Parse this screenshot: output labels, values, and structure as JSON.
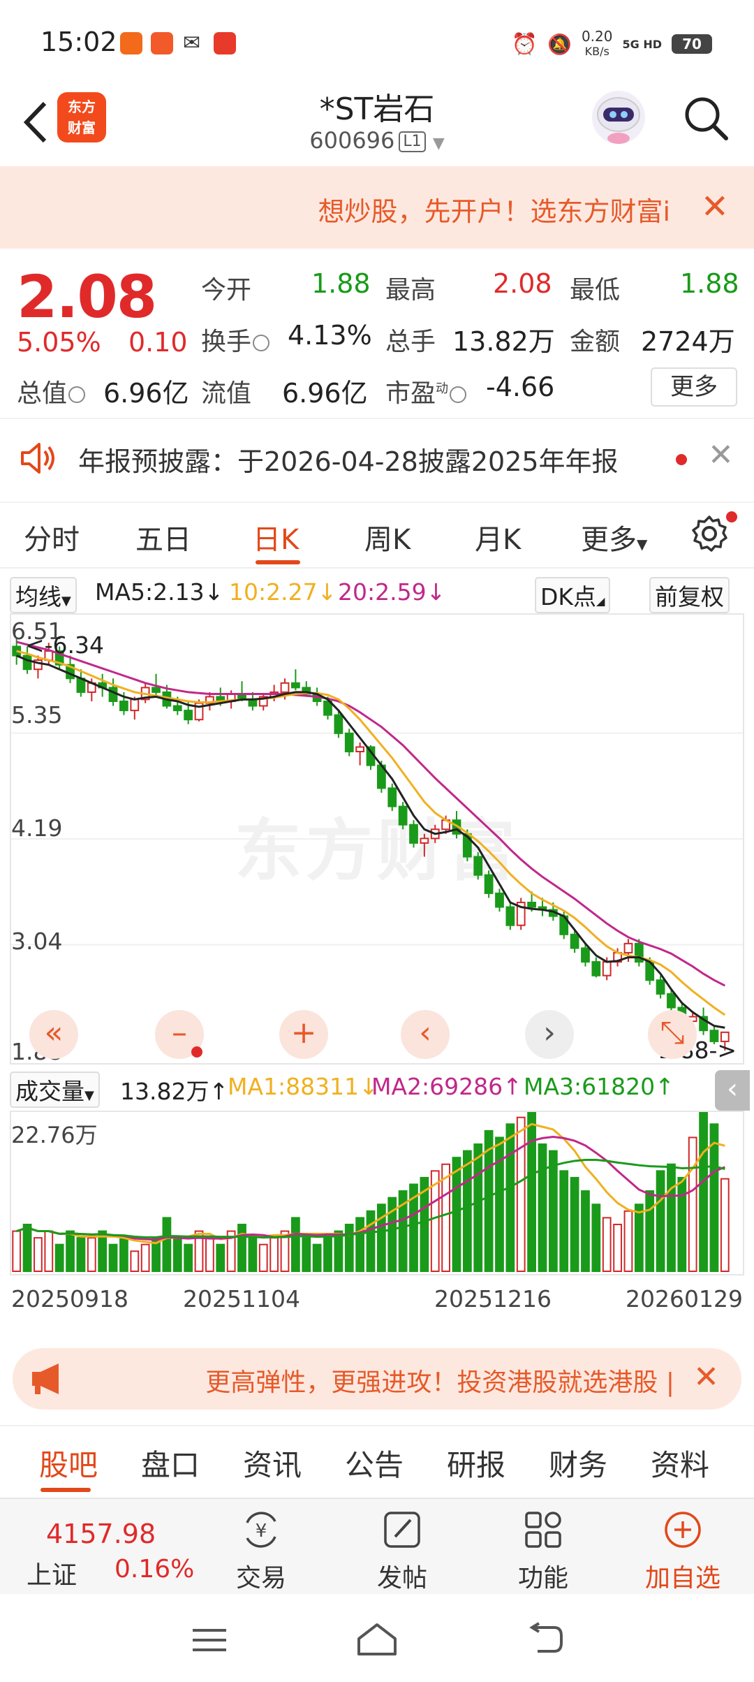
{
  "status_bar": {
    "time": "15:02",
    "net_speed": "0.20",
    "net_unit": "KB/s",
    "signal": "5G HD",
    "battery": "70"
  },
  "header": {
    "back_icon": "chevron-left-icon",
    "logo_line1": "东方",
    "logo_line2": "财富",
    "title": "*ST岩石",
    "code": "600696",
    "level": "L1"
  },
  "promo": {
    "text": "想炒股，先开户！选东方财富i",
    "close": "✕"
  },
  "quote": {
    "price": "2.08",
    "change_pct": "5.05%",
    "change_abs": "0.10",
    "fields": [
      {
        "label": "今开",
        "value": "1.88",
        "color": "green"
      },
      {
        "label": "最高",
        "value": "2.08",
        "color": "red"
      },
      {
        "label": "最低",
        "value": "1.88",
        "color": "green"
      },
      {
        "label": "换手",
        "value": "4.13%",
        "color": "plain"
      },
      {
        "label": "总手",
        "value": "13.82万",
        "color": "plain"
      },
      {
        "label": "金额",
        "value": "2724万",
        "color": "plain"
      },
      {
        "label": "总值",
        "value": "6.96亿",
        "color": "plain"
      },
      {
        "label": "流值",
        "value": "6.96亿",
        "color": "plain"
      },
      {
        "label": "市盈",
        "value": "-4.66",
        "color": "plain"
      }
    ],
    "pe_superscript": "动",
    "more": "更多"
  },
  "announcement": {
    "text": "年报预披露：于2026-04-28披露2025年年报"
  },
  "period_tabs": [
    "分时",
    "五日",
    "日K",
    "周K",
    "月K",
    "更多"
  ],
  "ma": {
    "selector": "均线",
    "ma5": "MA5:2.13",
    "ma10": "10:2.27",
    "ma20": "20:2.59",
    "dk": "DK点",
    "adjust": "前复权",
    "colors": {
      "ma5": "#222222",
      "ma10": "#f0b020",
      "ma20": "#c0288a"
    }
  },
  "chart_data": {
    "type": "candlestick",
    "y_ticks": [
      "6.51",
      "5.35",
      "4.19",
      "3.04",
      "1.88"
    ],
    "max_label": "<-6.34",
    "min_label": "1.88->",
    "watermark": "东方财富",
    "colors": {
      "up": "#d0282a",
      "down": "#1a9a1a"
    },
    "ylim": [
      1.88,
      6.51
    ],
    "candles": [
      [
        6.3,
        6.4,
        6.1,
        6.2
      ],
      [
        6.2,
        6.3,
        6.0,
        6.05
      ],
      [
        6.05,
        6.2,
        5.95,
        6.15
      ],
      [
        6.15,
        6.34,
        6.1,
        6.25
      ],
      [
        6.25,
        6.3,
        6.05,
        6.1
      ],
      [
        6.1,
        6.2,
        5.9,
        5.95
      ],
      [
        5.95,
        6.05,
        5.75,
        5.8
      ],
      [
        5.8,
        5.95,
        5.7,
        5.9
      ],
      [
        5.9,
        6.0,
        5.75,
        5.85
      ],
      [
        5.85,
        5.95,
        5.65,
        5.7
      ],
      [
        5.7,
        5.8,
        5.55,
        5.6
      ],
      [
        5.6,
        5.75,
        5.5,
        5.72
      ],
      [
        5.72,
        5.9,
        5.68,
        5.85
      ],
      [
        5.85,
        6.0,
        5.75,
        5.8
      ],
      [
        5.8,
        5.88,
        5.62,
        5.65
      ],
      [
        5.65,
        5.75,
        5.55,
        5.6
      ],
      [
        5.6,
        5.7,
        5.45,
        5.5
      ],
      [
        5.5,
        5.72,
        5.48,
        5.68
      ],
      [
        5.68,
        5.8,
        5.6,
        5.75
      ],
      [
        5.75,
        5.85,
        5.65,
        5.7
      ],
      [
        5.7,
        5.82,
        5.62,
        5.78
      ],
      [
        5.78,
        5.92,
        5.7,
        5.72
      ],
      [
        5.72,
        5.8,
        5.6,
        5.65
      ],
      [
        5.65,
        5.78,
        5.6,
        5.75
      ],
      [
        5.75,
        5.88,
        5.7,
        5.8
      ],
      [
        5.8,
        5.95,
        5.72,
        5.9
      ],
      [
        5.9,
        6.05,
        5.82,
        5.85
      ],
      [
        5.85,
        5.92,
        5.75,
        5.78
      ],
      [
        5.78,
        5.85,
        5.65,
        5.7
      ],
      [
        5.7,
        5.75,
        5.5,
        5.55
      ],
      [
        5.55,
        5.6,
        5.3,
        5.35
      ],
      [
        5.35,
        5.4,
        5.1,
        5.15
      ],
      [
        5.15,
        5.25,
        5.0,
        5.2
      ],
      [
        5.2,
        5.22,
        4.95,
        5.0
      ],
      [
        5.0,
        5.05,
        4.7,
        4.75
      ],
      [
        4.75,
        4.8,
        4.5,
        4.55
      ],
      [
        4.55,
        4.6,
        4.3,
        4.35
      ],
      [
        4.35,
        4.4,
        4.1,
        4.15
      ],
      [
        4.15,
        4.25,
        4.0,
        4.2
      ],
      [
        4.2,
        4.35,
        4.15,
        4.3
      ],
      [
        4.3,
        4.45,
        4.25,
        4.4
      ],
      [
        4.4,
        4.5,
        4.2,
        4.25
      ],
      [
        4.25,
        4.3,
        3.95,
        4.0
      ],
      [
        4.0,
        4.05,
        3.75,
        3.8
      ],
      [
        3.8,
        3.85,
        3.55,
        3.6
      ],
      [
        3.6,
        3.65,
        3.4,
        3.45
      ],
      [
        3.45,
        3.5,
        3.2,
        3.25
      ],
      [
        3.25,
        3.55,
        3.2,
        3.5
      ],
      [
        3.5,
        3.62,
        3.4,
        3.45
      ],
      [
        3.45,
        3.55,
        3.35,
        3.42
      ],
      [
        3.42,
        3.5,
        3.3,
        3.35
      ],
      [
        3.35,
        3.4,
        3.1,
        3.15
      ],
      [
        3.15,
        3.2,
        2.95,
        3.0
      ],
      [
        3.0,
        3.05,
        2.8,
        2.85
      ],
      [
        2.85,
        2.9,
        2.68,
        2.7
      ],
      [
        2.7,
        2.9,
        2.65,
        2.85
      ],
      [
        2.85,
        3.0,
        2.8,
        2.95
      ],
      [
        2.95,
        3.1,
        2.85,
        3.05
      ],
      [
        3.05,
        3.1,
        2.8,
        2.85
      ],
      [
        2.85,
        2.9,
        2.6,
        2.65
      ],
      [
        2.65,
        2.7,
        2.45,
        2.5
      ],
      [
        2.5,
        2.55,
        2.3,
        2.35
      ],
      [
        2.35,
        2.4,
        2.15,
        2.2
      ],
      [
        2.2,
        2.3,
        2.1,
        2.25
      ],
      [
        2.25,
        2.35,
        2.05,
        2.1
      ],
      [
        2.1,
        2.15,
        1.95,
        1.98
      ],
      [
        1.98,
        2.08,
        1.88,
        2.08
      ]
    ],
    "ma5": [
      6.2,
      6.15,
      6.12,
      6.1,
      6.05,
      6.0,
      5.95,
      5.9,
      5.85,
      5.8,
      5.75,
      5.72,
      5.74,
      5.75,
      5.72,
      5.7,
      5.66,
      5.64,
      5.66,
      5.68,
      5.7,
      5.72,
      5.72,
      5.73,
      5.75,
      5.78,
      5.8,
      5.8,
      5.78,
      5.72,
      5.6,
      5.45,
      5.3,
      5.15,
      5.0,
      4.85,
      4.65,
      4.45,
      4.3,
      4.25,
      4.27,
      4.3,
      4.22,
      4.1,
      3.9,
      3.7,
      3.5,
      3.45,
      3.43,
      3.42,
      3.4,
      3.35,
      3.2,
      3.05,
      2.92,
      2.85,
      2.86,
      2.9,
      2.9,
      2.85,
      2.72,
      2.55,
      2.4,
      2.3,
      2.22,
      2.15,
      2.13
    ],
    "ma10": [
      6.25,
      6.22,
      6.18,
      6.15,
      6.12,
      6.08,
      6.03,
      5.98,
      5.93,
      5.88,
      5.84,
      5.8,
      5.78,
      5.76,
      5.74,
      5.72,
      5.7,
      5.69,
      5.69,
      5.7,
      5.71,
      5.72,
      5.72,
      5.73,
      5.74,
      5.76,
      5.78,
      5.79,
      5.79,
      5.77,
      5.72,
      5.62,
      5.5,
      5.36,
      5.22,
      5.08,
      4.92,
      4.76,
      4.6,
      4.48,
      4.4,
      4.34,
      4.26,
      4.17,
      4.06,
      3.94,
      3.81,
      3.7,
      3.6,
      3.53,
      3.47,
      3.41,
      3.33,
      3.23,
      3.12,
      3.02,
      2.95,
      2.92,
      2.9,
      2.87,
      2.82,
      2.74,
      2.63,
      2.53,
      2.44,
      2.35,
      2.27
    ],
    "ma20": [
      6.35,
      6.32,
      6.29,
      6.26,
      6.22,
      6.18,
      6.14,
      6.1,
      6.06,
      6.02,
      5.98,
      5.94,
      5.9,
      5.87,
      5.84,
      5.82,
      5.8,
      5.79,
      5.78,
      5.78,
      5.78,
      5.78,
      5.78,
      5.78,
      5.78,
      5.78,
      5.77,
      5.76,
      5.75,
      5.73,
      5.7,
      5.65,
      5.58,
      5.5,
      5.42,
      5.32,
      5.22,
      5.1,
      4.98,
      4.86,
      4.75,
      4.64,
      4.53,
      4.42,
      4.31,
      4.2,
      4.08,
      3.97,
      3.87,
      3.78,
      3.7,
      3.62,
      3.54,
      3.45,
      3.36,
      3.27,
      3.19,
      3.12,
      3.07,
      3.03,
      2.99,
      2.94,
      2.87,
      2.8,
      2.72,
      2.65,
      2.59
    ]
  },
  "controls": [
    "«",
    "–",
    "+",
    "‹",
    "›",
    "⤡"
  ],
  "volume": {
    "selector": "成交量",
    "current": "13.82万",
    "ma1": "MA1:88311",
    "ma2": "MA2:69286",
    "ma3": "MA3:61820",
    "max_label": "22.76万",
    "colors": {
      "ma1": "#f0b020",
      "ma2": "#c0288a",
      "ma3": "#1a9a1a"
    },
    "values": [
      6,
      7,
      5,
      6,
      4,
      6,
      5,
      5,
      6,
      4,
      5,
      3,
      4,
      5,
      8,
      5,
      4,
      6,
      5,
      4,
      6,
      7,
      5,
      4,
      5,
      6,
      8,
      5,
      4,
      5,
      6,
      7,
      8,
      9,
      10,
      11,
      12,
      13,
      14,
      15,
      16,
      17,
      18,
      19,
      21,
      20,
      22,
      23,
      24,
      19,
      18,
      15,
      14,
      12,
      10,
      8,
      7,
      9,
      10,
      12,
      15,
      16,
      14,
      20,
      24,
      22,
      13.82
    ],
    "up_flags": [
      1,
      0,
      1,
      1,
      0,
      0,
      0,
      1,
      0,
      0,
      0,
      1,
      1,
      0,
      0,
      0,
      0,
      1,
      1,
      0,
      1,
      0,
      0,
      1,
      1,
      1,
      0,
      0,
      0,
      0,
      0,
      0,
      0,
      0,
      0,
      0,
      0,
      0,
      0,
      1,
      1,
      0,
      0,
      0,
      0,
      0,
      0,
      1,
      0,
      0,
      0,
      0,
      0,
      0,
      0,
      1,
      1,
      1,
      0,
      0,
      0,
      0,
      0,
      1,
      0,
      0,
      1
    ]
  },
  "dates": [
    "20250918",
    "20251104",
    "20251216",
    "20260129"
  ],
  "ad2": {
    "text": "更高弹性，更强进攻！投资港股就选港股 |"
  },
  "content_tabs": [
    "股吧",
    "盘口",
    "资讯",
    "公告",
    "研报",
    "财务",
    "资料"
  ],
  "bottom_bar": {
    "index_value": "4157.98",
    "index_name": "上证",
    "index_change": "0.16%",
    "items": [
      {
        "label": "交易",
        "icon": "trade-icon"
      },
      {
        "label": "发帖",
        "icon": "edit-icon"
      },
      {
        "label": "功能",
        "icon": "grid-icon"
      },
      {
        "label": "加自选",
        "icon": "add-circle-icon"
      }
    ]
  }
}
